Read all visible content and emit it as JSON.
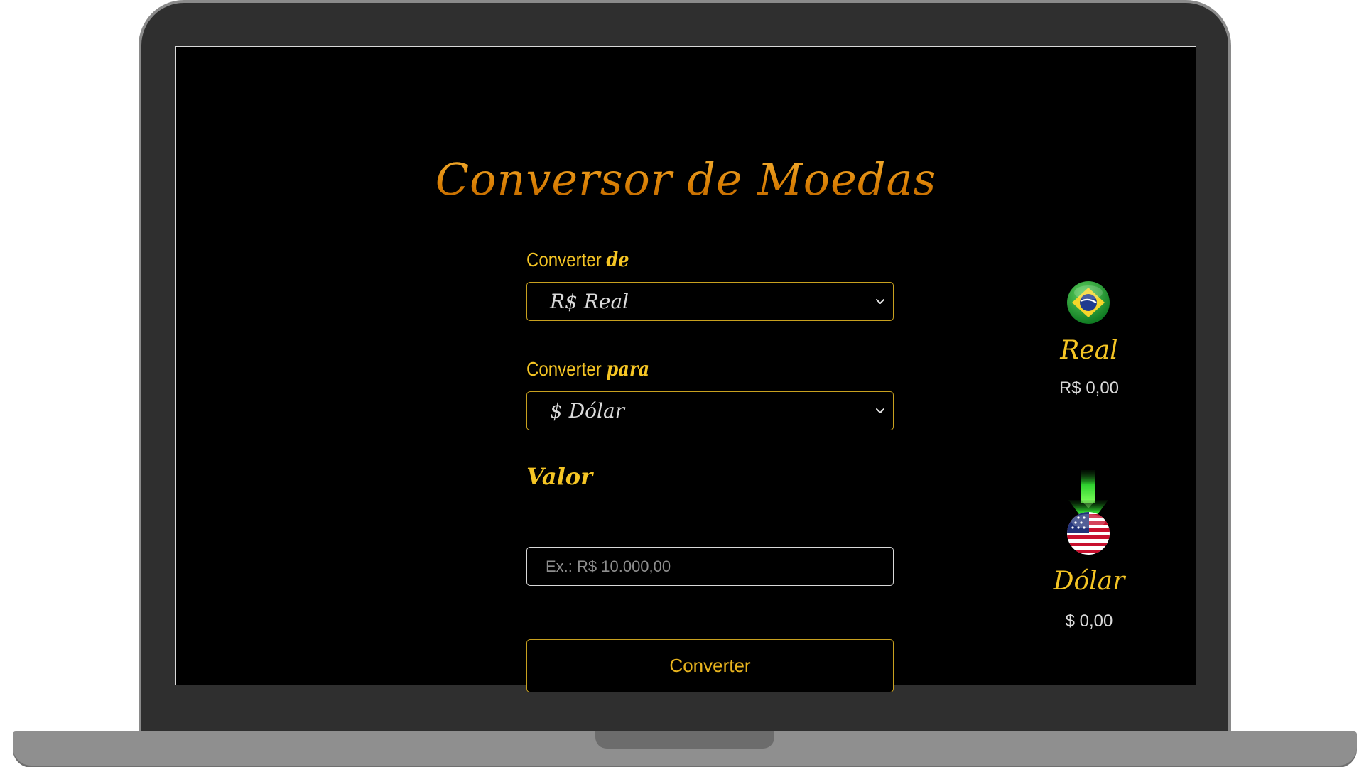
{
  "app": {
    "title": "Conversor de Moedas"
  },
  "form": {
    "from_label_prefix": "Converter",
    "from_label_script": "de",
    "from_selected": "R$ Real",
    "to_label_prefix": "Converter",
    "to_label_script": "para",
    "to_selected": "$ Dólar",
    "value_label": "Valor",
    "value_placeholder": "Ex.: R$ 10.000,00",
    "value_current": "",
    "convert_label": "Converter"
  },
  "result": {
    "from_currency_name": "Real",
    "from_currency_value": "R$ 0,00",
    "to_currency_name": "Dólar",
    "to_currency_value": "$ 0,00",
    "from_flag_icon": "brazil-flag-icon",
    "to_flag_icon": "usa-flag-icon",
    "arrow_icon": "arrow-down-icon"
  },
  "colors": {
    "accent_gold": "#f5c524",
    "title_orange": "#e8920c",
    "screen_bg": "#000000",
    "arrow_green": "#2fd12f"
  }
}
